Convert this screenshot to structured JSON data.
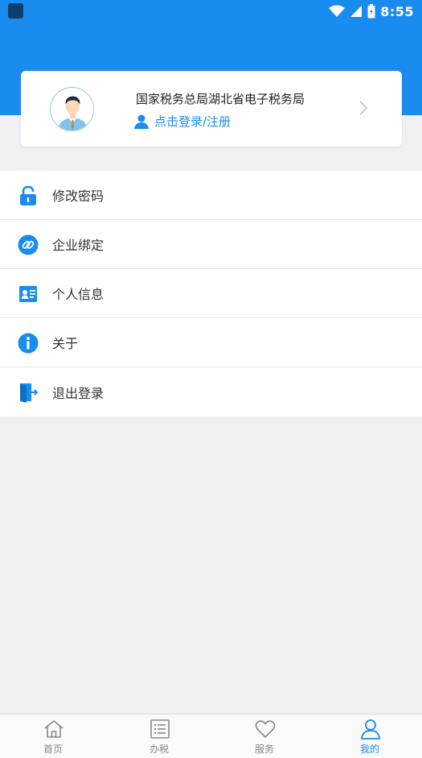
{
  "status_bar": {
    "time": "8:55"
  },
  "profile": {
    "title": "国家税务总局湖北省电子税务局",
    "login_link": "点击登录/注册"
  },
  "menu": {
    "items": [
      {
        "label": "修改密码",
        "icon": "lock-icon"
      },
      {
        "label": "企业绑定",
        "icon": "link-icon"
      },
      {
        "label": "个人信息",
        "icon": "id-card-icon"
      },
      {
        "label": "关于",
        "icon": "info-icon"
      },
      {
        "label": "退出登录",
        "icon": "logout-door-icon"
      }
    ]
  },
  "tabbar": {
    "tabs": [
      {
        "label": "首页",
        "icon": "home-icon",
        "active": false
      },
      {
        "label": "办税",
        "icon": "list-icon",
        "active": false
      },
      {
        "label": "服务",
        "icon": "heart-icon",
        "active": false
      },
      {
        "label": "我的",
        "icon": "user-icon",
        "active": true
      }
    ]
  },
  "colors": {
    "primary": "#1a8cf0",
    "background": "#efeff4"
  }
}
